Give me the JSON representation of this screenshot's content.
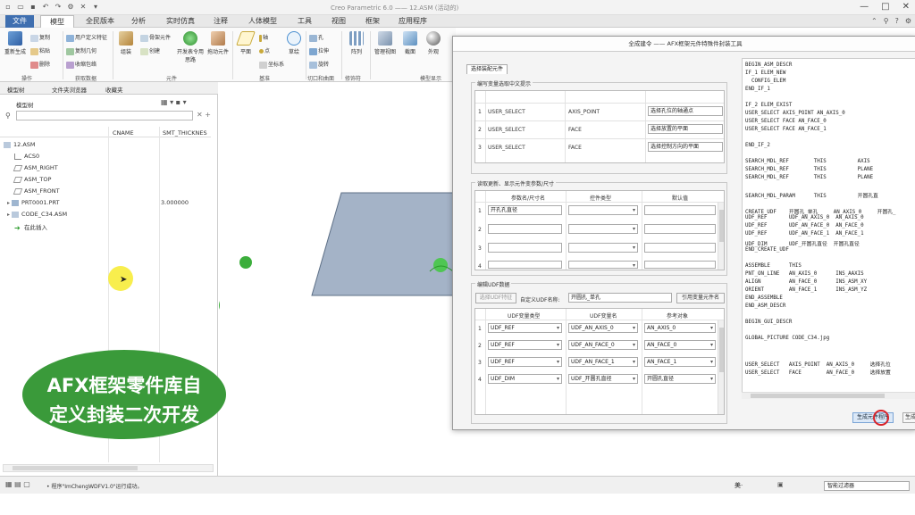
{
  "window": {
    "title": "Creo Parametric 6.0 —— 12.ASM (活动的)",
    "minimize": "—",
    "maximize": "□",
    "close": "✕"
  },
  "menu": {
    "tabs": [
      "文件",
      "模型",
      "全民版本",
      "分析",
      "实时仿真",
      "注释",
      "人体模型",
      "工具",
      "视图",
      "框架",
      "应用程序"
    ]
  },
  "ribbon": {
    "regenerate": "重新生成",
    "copy": "复制",
    "paste": "粘贴",
    "delete": "删除",
    "user_defined_feature": "用户定义特征",
    "copy_geometry": "复制几何",
    "shrinkwrap": "收缩包络",
    "assemble": "组装",
    "create": "创建",
    "skeleton_component": "骨架元件",
    "open_design": "开发表令用思路",
    "drag_components": "拖动元件",
    "plane": "平面",
    "axis": "轴",
    "point": "点",
    "csys": "坐标系",
    "sketch": "草绘",
    "hole": "孔",
    "extrude": "拉伸",
    "revolve": "旋转",
    "pattern": "阵列",
    "manage_views": "管理视图",
    "section": "截面",
    "appearance": "外观",
    "group_operations": "操作",
    "group_get_data": "获取数据",
    "group_component": "元件",
    "group_datum": "基准",
    "group_cut_surface": "切口和曲面",
    "group_modifiers": "修饰符",
    "group_model_display": "模型显示"
  },
  "left_panel": {
    "tabs": [
      "模型树",
      "文件夹浏览器",
      "收藏夹"
    ],
    "section_title": "模型树",
    "columns": [
      "CNAME",
      "SMT_THICKNES"
    ],
    "tree": [
      {
        "label": "12.ASM",
        "value": ""
      },
      {
        "label": "ACS0",
        "value": ""
      },
      {
        "label": "ASM_RIGHT",
        "value": ""
      },
      {
        "label": "ASM_TOP",
        "value": ""
      },
      {
        "label": "ASM_FRONT",
        "value": ""
      },
      {
        "label": "PRT0001.PRT",
        "value": "3.000000"
      },
      {
        "label": "CODE_C34.ASM",
        "value": ""
      },
      {
        "label": "在此插入",
        "value": ""
      }
    ]
  },
  "status": {
    "message": "• 程序\"ImChengWDFV1.0\"运行成功。",
    "selector": "智能过滤器",
    "label": "美·"
  },
  "dialog": {
    "title": "全成建令 —— AFX框架元件特殊件封装工具",
    "tab": "选择装配元件",
    "group1": {
      "label": "编写变量选取中文提示",
      "rows": [
        {
          "num": "1",
          "col1": "USER_SELECT",
          "col2": "AXIS_POINT",
          "col3": "选择孔位的轴通点"
        },
        {
          "num": "2",
          "col1": "USER_SELECT",
          "col2": "FACE",
          "col3": "选择放置的平面"
        },
        {
          "num": "3",
          "col1": "USER_SELECT",
          "col2": "FACE",
          "col3": "选择控制方向的平面"
        }
      ]
    },
    "group2": {
      "label": "读取更新、显示元件变参数/尺寸",
      "headers": [
        "参数名/尺寸名",
        "控件类型",
        "默认值"
      ],
      "rows": [
        {
          "num": "1",
          "c1": "开孔孔直径",
          "c2": "",
          "c3": ""
        },
        {
          "num": "2",
          "c1": "",
          "c2": "",
          "c3": ""
        },
        {
          "num": "3",
          "c1": "",
          "c2": "",
          "c3": ""
        },
        {
          "num": "4",
          "c1": "",
          "c2": "",
          "c3": ""
        }
      ]
    },
    "group3": {
      "label": "编辑UDF数据",
      "btn_pick": "选择UDF特征",
      "name_label": "自定义UDF名称:",
      "name_value": "开圆孔_单孔",
      "btn_ref": "引用变量元件名",
      "headers": [
        "UDF变量类型",
        "UDF变量名",
        "参考对象"
      ],
      "rows": [
        {
          "num": "1",
          "c1": "UDF_REF",
          "c2": "UDF_AN_AXIS_0",
          "c3": "AN_AXIS_0"
        },
        {
          "num": "2",
          "c1": "UDF_REF",
          "c2": "UDF_AN_FACE_0",
          "c3": "AN_FACE_0"
        },
        {
          "num": "3",
          "c1": "UDF_REF",
          "c2": "UDF_AN_FACE_1",
          "c3": "AN_FACE_1"
        },
        {
          "num": "4",
          "c1": "UDF_DIM",
          "c2": "UDF_开圆孔直径",
          "c3": "开圆孔直径"
        }
      ]
    },
    "code": [
      "BEGIN_ASM_DESCR",
      "IF_1 ELEM_NEW",
      "  CONFIG_ELEM",
      "END_IF_1",
      "",
      "IF_2 ELEM_EXIST",
      "USER_SELECT AXIS_POINT AN_AXIS_0",
      "USER_SELECT FACE AN_FACE_0",
      "USER_SELECT FACE AN_FACE_1",
      "",
      "END_IF_2",
      "",
      "SEARCH_MDL_REF        THIS          AXIS",
      "SEARCH_MDL_REF        THIS          PLANE",
      "SEARCH_MDL_REF        THIS          PLANE",
      "",
      "SEARCH_MDL_PARAM      THIS          开圆孔直",
      "",
      "CREATE_UDF    开圆孔_单孔     AN_AXIS_0     开圆孔_",
      "UDF_REF       UDF_AN_AXIS_0  AN_AXIS_0",
      "UDF_REF       UDF_AN_FACE_0  AN_FACE_0",
      "UDF_REF       UDF_AN_FACE_1  AN_FACE_1",
      "UDF_DIM       UDF_开圆孔直径  开圆孔直径",
      "END_CREATE_UDF",
      "",
      "ASSEMBLE      THIS",
      "PNT_ON_LINE   AN_AXIS_0      INS_AAXIS",
      "ALIGN         AN_FACE_0      INS_ASM_XY",
      "ORIENT        AN_FACE_1      INS_ASM_YZ",
      "END_ASSEMBLE",
      "END_ASM_DESCR",
      "",
      "BEGIN_GUI_DESCR",
      "",
      "GLOBAL_PICTURE CODE_C34.jpg",
      "",
      "",
      "USER_SELECT   AXIS_POINT  AN_AXIS_0     选择孔位",
      "USER_SELECT   FACE        AN_FACE_0     选择放置"
    ],
    "btn_generate": "生成元件程序",
    "btn_generate2": "生成"
  },
  "overlay": {
    "line1": "AFX框架零件库自",
    "line2": "定义封装二次开发"
  },
  "colors": {
    "file_tab": "#3f6fb0",
    "caption_green": "#3a9a3a",
    "plate": "#a4b3c7",
    "marker_green": "#3cae3c",
    "cursor_yellow": "#f7ec3a"
  }
}
